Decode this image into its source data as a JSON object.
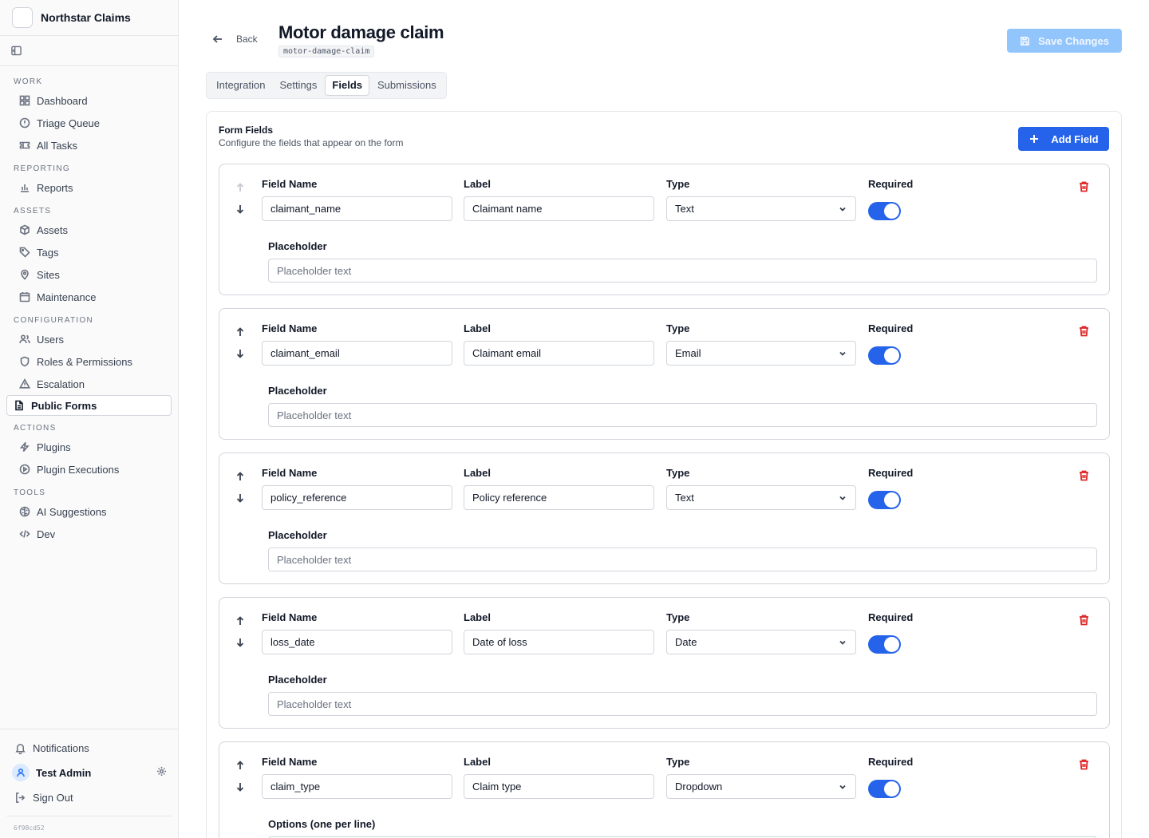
{
  "app": {
    "name": "Northstar Claims",
    "version": "6f98cd52"
  },
  "nav": {
    "sections": [
      {
        "title": "WORK",
        "items": [
          {
            "label": "Dashboard",
            "icon": "dashboard-icon"
          },
          {
            "label": "Triage Queue",
            "icon": "alert-circle-icon"
          },
          {
            "label": "All Tasks",
            "icon": "ticket-icon"
          }
        ]
      },
      {
        "title": "REPORTING",
        "items": [
          {
            "label": "Reports",
            "icon": "bar-chart-icon"
          }
        ]
      },
      {
        "title": "ASSETS",
        "items": [
          {
            "label": "Assets",
            "icon": "box-icon"
          },
          {
            "label": "Tags",
            "icon": "tag-icon"
          },
          {
            "label": "Sites",
            "icon": "map-pin-icon"
          },
          {
            "label": "Maintenance",
            "icon": "calendar-icon"
          }
        ]
      },
      {
        "title": "CONFIGURATION",
        "items": [
          {
            "label": "Users",
            "icon": "users-icon"
          },
          {
            "label": "Roles & Permissions",
            "icon": "shield-icon"
          },
          {
            "label": "Escalation",
            "icon": "warning-triangle-icon"
          },
          {
            "label": "Public Forms",
            "icon": "file-text-icon",
            "active": true
          }
        ]
      },
      {
        "title": "ACTIONS",
        "items": [
          {
            "label": "Plugins",
            "icon": "zap-icon"
          },
          {
            "label": "Plugin Executions",
            "icon": "play-circle-icon"
          }
        ]
      },
      {
        "title": "TOOLS",
        "items": [
          {
            "label": "AI Suggestions",
            "icon": "brain-icon"
          },
          {
            "label": "Dev",
            "icon": "code-icon"
          }
        ]
      }
    ]
  },
  "sidebar_bottom": {
    "notifications": "Notifications",
    "user_name": "Test Admin",
    "sign_out": "Sign Out"
  },
  "header": {
    "back_label": "Back",
    "title": "Motor damage claim",
    "slug": "motor-damage-claim",
    "save_label": "Save Changes"
  },
  "tabs": [
    {
      "label": "Integration"
    },
    {
      "label": "Settings"
    },
    {
      "label": "Fields",
      "active": true
    },
    {
      "label": "Submissions"
    }
  ],
  "form_fields": {
    "title": "Form Fields",
    "subtitle": "Configure the fields that appear on the form",
    "add_label": "Add Field",
    "col_field_name": "Field Name",
    "col_label": "Label",
    "col_type": "Type",
    "col_required": "Required",
    "placeholder_label": "Placeholder",
    "options_label": "Options (one per line)",
    "placeholder_hint": "Placeholder text",
    "fields": [
      {
        "name": "claimant_name",
        "label": "Claimant name",
        "type": "Text",
        "required": true
      },
      {
        "name": "claimant_email",
        "label": "Claimant email",
        "type": "Email",
        "required": true
      },
      {
        "name": "policy_reference",
        "label": "Policy reference",
        "type": "Text",
        "required": true
      },
      {
        "name": "loss_date",
        "label": "Date of loss",
        "type": "Date",
        "required": true
      },
      {
        "name": "claim_type",
        "label": "Claim type",
        "type": "Dropdown",
        "required": true
      }
    ]
  },
  "colors": {
    "primary": "#2563eb",
    "primary_disabled": "#93c5fd",
    "danger": "#dc2626"
  }
}
